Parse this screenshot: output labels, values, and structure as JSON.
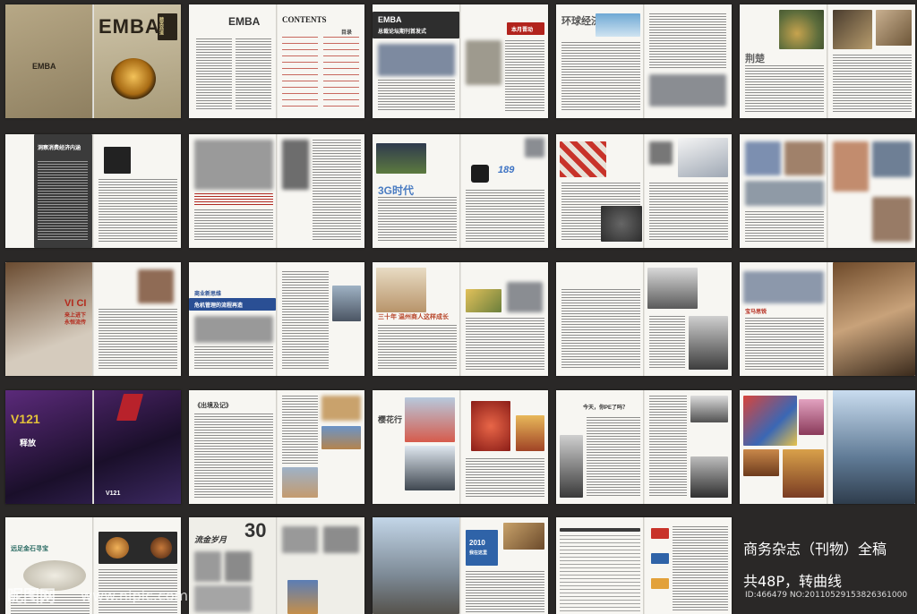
{
  "caption": {
    "line1": "商务杂志（刊物）全稿",
    "line2": "共48P，转曲线",
    "id_line": "ID:466479 NO:20110529153826361000"
  },
  "watermark": {
    "brand": "昵图网",
    "url": "www.nipic.com"
  },
  "spreads": {
    "s01": {
      "logo_top": "EMBA",
      "logo_bottom": "EMBA",
      "side": "精英商道"
    },
    "s02": {
      "logo": "EMBA",
      "contents": "CONTENTS",
      "mulu": "目录"
    },
    "s03": {
      "title": "EMBA",
      "subtitle": "总裁论坛期刊首发式",
      "tag": "本月晋动"
    },
    "s04": {
      "title": "环球经济"
    },
    "s05": {
      "title": "荆楚"
    },
    "s06": {
      "headline": "洞察消费经济内涵"
    },
    "s08": {
      "title": "3G时代",
      "tag": "189"
    },
    "s11": {
      "v1": "VI CI",
      "v2": "来上进下",
      "v3": "永恒流传"
    },
    "s12": {
      "headline": "商业新思维",
      "sub": "危机管理的流程再造"
    },
    "s13": {
      "headline": "三十年 温州商人这样成长"
    },
    "s15": {
      "title": "宝马思锐"
    },
    "s16": {
      "v1": "V121",
      "v2": "释放",
      "v3": "V121"
    },
    "s17": {
      "title": "《出境及记》"
    },
    "s18": {
      "title": "樱花行"
    },
    "s19": {
      "title": "今天，你PE了吗？"
    },
    "s21": {
      "title": "远足金石寻宝"
    },
    "s22": {
      "title": "30",
      "sub": "流金岁月"
    },
    "s23": {
      "title": "2010",
      "sub": "我在这里"
    }
  }
}
